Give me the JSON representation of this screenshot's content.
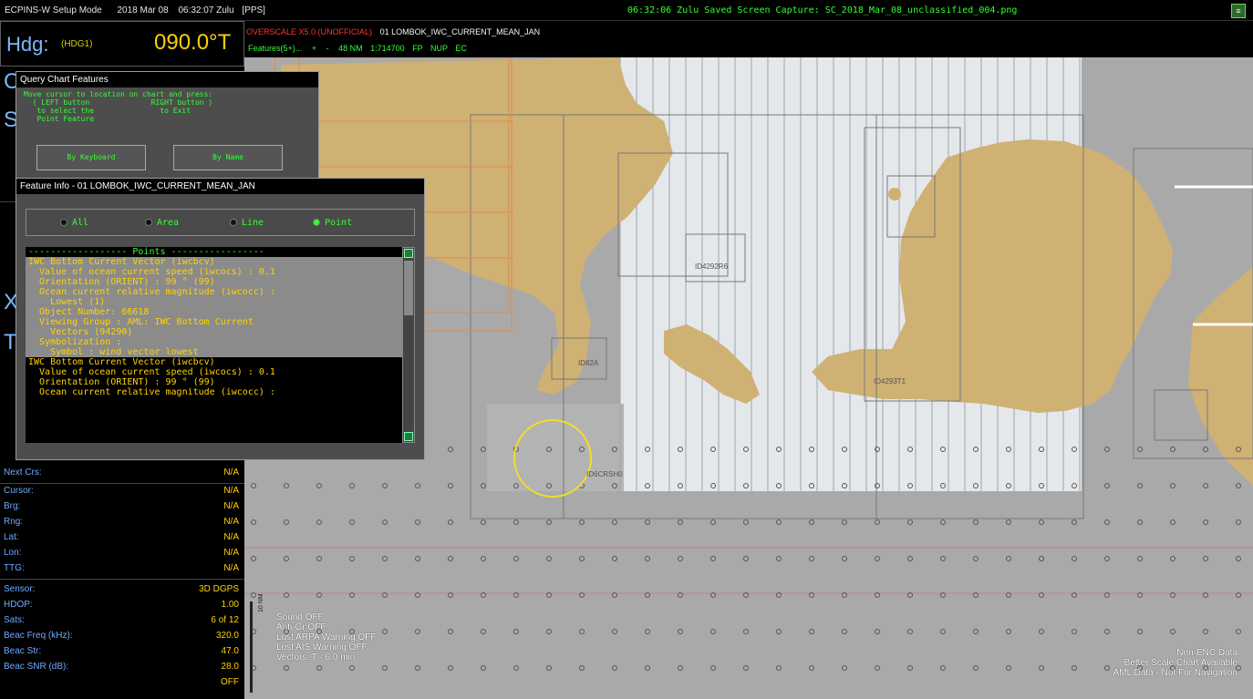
{
  "topbar": {
    "title": "ECPINS-W  Setup Mode",
    "date": "2018 Mar 08",
    "time": "06:32:07 Zulu",
    "fix": "[PPS]",
    "capture": "06:32:06 Zulu  Saved Screen Capture: SC_2018_Mar_08_unclassified_004.png"
  },
  "heading": {
    "label": "Hdg:",
    "source": "(HDG1)",
    "value": "090.0°T"
  },
  "chart_info": {
    "overscale": "OVERSCALE X5.0 (UNOFFICIAL)",
    "chart_name": "01 LOMBOK_IWC_CURRENT_MEAN_JAN",
    "features": "Features(5+)...",
    "plus": "+",
    "minus": "-",
    "range": "48 NM",
    "scale": "1:714700",
    "fp": "FP",
    "orientation": "NUP",
    "ec": "EC"
  },
  "nav": {
    "rows_a": [
      {
        "k": "Next Crs:",
        "v": "N/A"
      }
    ],
    "rows_b": [
      {
        "k": "Cursor:",
        "v": "N/A"
      },
      {
        "k": "Brg:",
        "v": "N/A"
      },
      {
        "k": "Rng:",
        "v": "N/A"
      },
      {
        "k": "Lat:",
        "v": "N/A"
      },
      {
        "k": "Lon:",
        "v": "N/A"
      },
      {
        "k": "TTG:",
        "v": "N/A"
      }
    ],
    "rows_c": [
      {
        "k": "Sensor:",
        "v": "3D DGPS"
      },
      {
        "k": "HDOP:",
        "v": "1.00"
      },
      {
        "k": "Sats:",
        "v": "6 of 12"
      },
      {
        "k": "Beac Freq (kHz):",
        "v": "320.0"
      },
      {
        "k": "Beac Str:",
        "v": "47.0"
      },
      {
        "k": "Beac SNR (dB):",
        "v": "28.0"
      },
      {
        "k": "",
        "v": "OFF"
      }
    ]
  },
  "query_dialog": {
    "title": "Query Chart Features",
    "instructions": [
      "Move cursor to location on chart and press:",
      "  ( LEFT button              RIGHT button )",
      "   to select the               to Exit",
      "   Point Feature"
    ],
    "by_keyboard": "By Keyboard",
    "by_name": "By Name"
  },
  "feature_dialog": {
    "title": "Feature Info - 01 LOMBOK_IWC_CURRENT_MEAN_JAN",
    "filters": [
      {
        "label": "All",
        "selected": false
      },
      {
        "label": "Area",
        "selected": false
      },
      {
        "label": "Line",
        "selected": false
      },
      {
        "label": "Point",
        "selected": true
      }
    ],
    "lines": [
      {
        "text": "------------------ Points -----------------",
        "style": "hd"
      },
      {
        "text": "IWC Bottom Current Vector (iwcbcv)",
        "style": "sel"
      },
      {
        "text": "  Value of ocean current speed (iwcocs) : 0.1",
        "style": "sel"
      },
      {
        "text": "  Orientation (ORIENT) : 99 ° (99)",
        "style": "sel"
      },
      {
        "text": "  Ocean current relative magnitude (iwcocc) :",
        "style": "sel"
      },
      {
        "text": "    Lowest (1)",
        "style": "sel"
      },
      {
        "text": "  Object Number: 66618",
        "style": "sel"
      },
      {
        "text": "  Viewing Group : AML: IWC Bottom Current",
        "style": "sel"
      },
      {
        "text": "    Vectors (94290)",
        "style": "sel"
      },
      {
        "text": "  Symbolization :",
        "style": "sel"
      },
      {
        "text": "    Symbol : wind vector lowest",
        "style": "sel"
      },
      {
        "text": "IWC Bottom Current Vector (iwcbcv)",
        "style": ""
      },
      {
        "text": "  Value of ocean current speed (iwcocs) : 0.1",
        "style": ""
      },
      {
        "text": "  Orientation (ORIENT) : 99 ° (99)",
        "style": ""
      },
      {
        "text": "  Ocean current relative magnitude (iwcocc) :",
        "style": ""
      }
    ]
  },
  "status_lines": [
    "Sound OFF",
    "Anti-Gr OFF",
    "Lost ARPA Warning OFF",
    "Lost AIS Warning OFF",
    "Vectors: T - 6.0 min"
  ],
  "scale_label": "10 NM",
  "notices": [
    "Non-ENC Data",
    "Better Scale Chart Available",
    "AML Data - Not For Navigation"
  ],
  "chart_labels": {
    "c1": "ID4292R6",
    "c2": "ID82A",
    "c3": "ID6CRSH0",
    "c4": "ID4293T1"
  },
  "colors": {
    "land": "#cfb174",
    "sea": "#a9a9a9",
    "shallow": "#e6eaed",
    "hud_green": "#33ff33",
    "hud_yellow": "#ffd400",
    "hud_blue": "#6fa9ff"
  }
}
